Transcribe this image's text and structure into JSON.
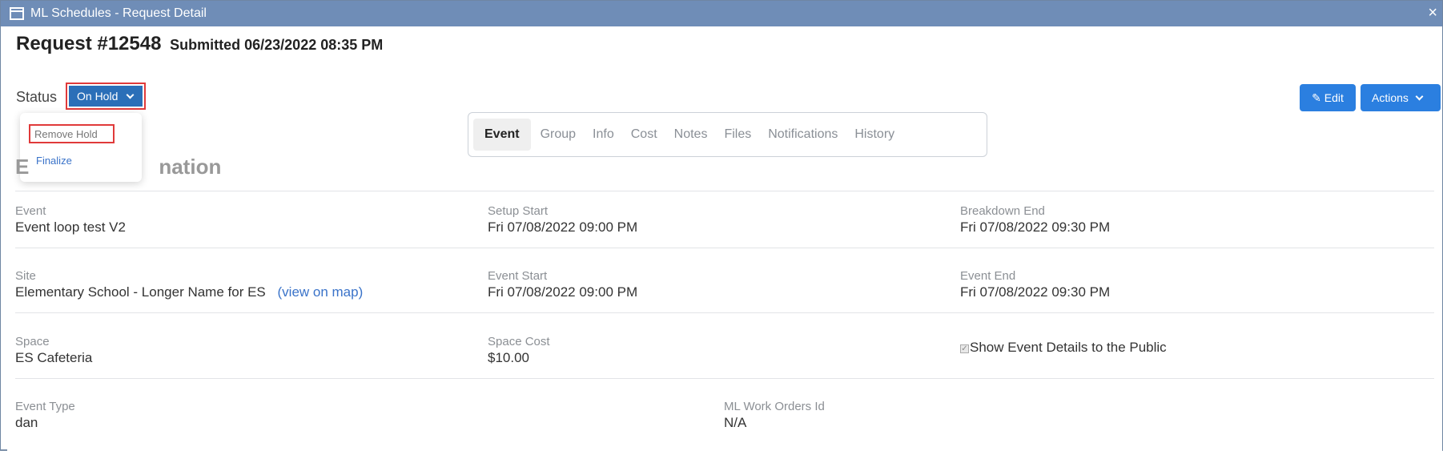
{
  "window": {
    "title": "ML Schedules - Request Detail",
    "close_glyph": "×"
  },
  "request": {
    "title": "Request #12548",
    "submitted": "Submitted 06/23/2022 08:35 PM"
  },
  "status": {
    "label": "Status",
    "current": "On Hold",
    "menu": [
      "Remove Hold",
      "Finalize"
    ]
  },
  "toolbar": {
    "edit_label": "Edit",
    "actions_label": "Actions"
  },
  "tabs": [
    "Event",
    "Group",
    "Info",
    "Cost",
    "Notes",
    "Files",
    "Notifications",
    "History"
  ],
  "section": {
    "title_visible": "E",
    "title_tail": "nation"
  },
  "fields": {
    "event": {
      "label": "Event",
      "value": "Event loop test V2"
    },
    "setup_start": {
      "label": "Setup Start",
      "value": "Fri 07/08/2022 09:00 PM"
    },
    "breakdown_end": {
      "label": "Breakdown End",
      "value": "Fri 07/08/2022 09:30 PM"
    },
    "site": {
      "label": "Site",
      "value": "Elementary School - Longer Name for ES",
      "link": "(view on map)"
    },
    "event_start": {
      "label": "Event Start",
      "value": "Fri 07/08/2022 09:00 PM"
    },
    "event_end": {
      "label": "Event End",
      "value": "Fri 07/08/2022 09:30 PM"
    },
    "space": {
      "label": "Space",
      "value": "ES Cafeteria"
    },
    "space_cost": {
      "label": "Space Cost",
      "value": "$10.00"
    },
    "show_public": {
      "label": "Show Event Details to the Public",
      "checked": true
    },
    "event_type": {
      "label": "Event Type",
      "value": "dan"
    },
    "work_orders": {
      "label": "ML Work Orders Id",
      "value": "N/A"
    }
  },
  "colors": {
    "titlebar": "#6f8db7",
    "primary": "#2b7fe0",
    "status_button": "#2b6fb8",
    "highlight": "#e03a3a",
    "link": "#3a73c9"
  }
}
